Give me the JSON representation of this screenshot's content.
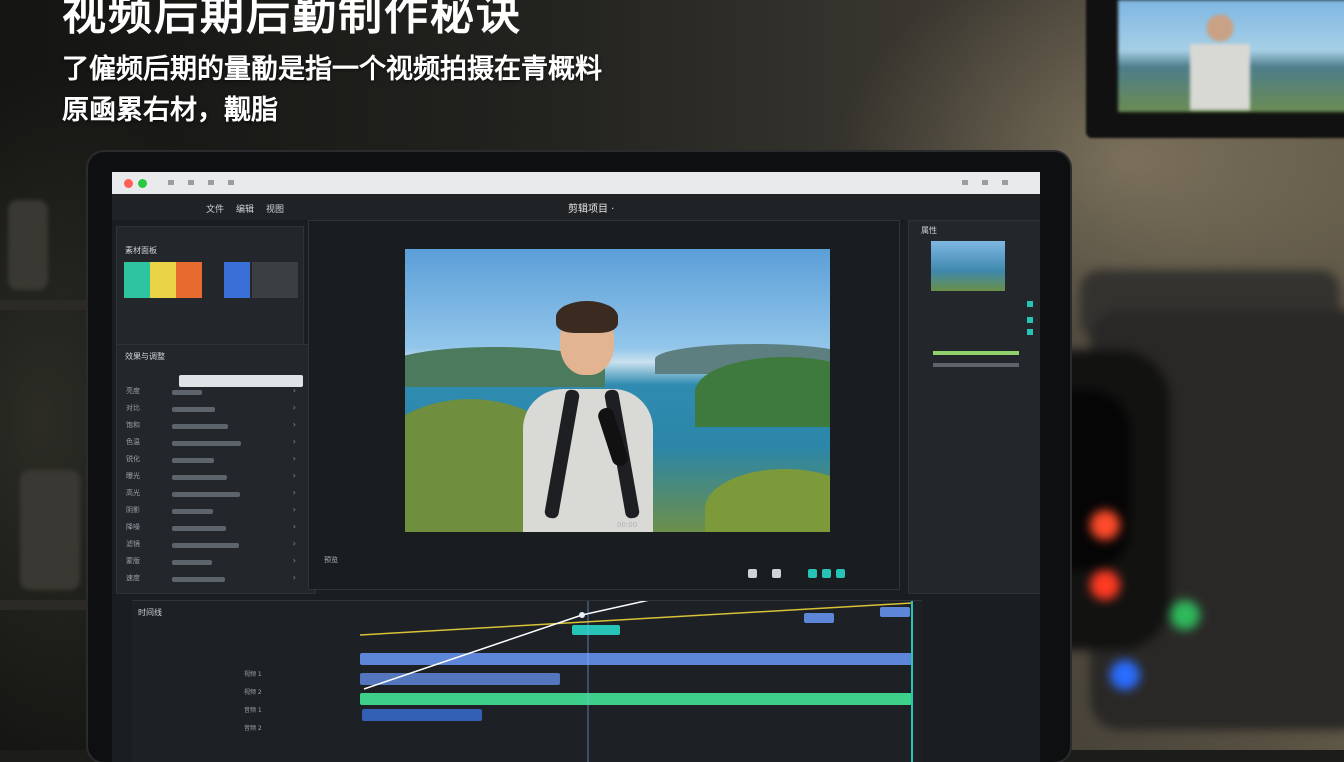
{
  "headline": {
    "title": "视频后期后勤制作秘诀",
    "subtitle_line1": "了僱频后期的量勈是指一个视频拍摄在青概料",
    "subtitle_line2": "原凾累右材，觏脂"
  },
  "editor": {
    "project_title": "剪辑项目 ·",
    "menu": [
      "文件",
      "编辑",
      "视图"
    ],
    "left_panel": {
      "title": "素材面板",
      "swatch_colors": [
        "#2ec4a0",
        "#e9d448",
        "#e86a2e",
        "#3a6fd8",
        "#3b3f44"
      ],
      "effects_title": "效果与调整",
      "items": [
        "亮度",
        "对比",
        "饱和",
        "色温",
        "锐化",
        "曝光",
        "高光",
        "阴影",
        "降噪",
        "滤镜",
        "蒙版",
        "速度"
      ]
    },
    "preview": {
      "timecode": "00:00",
      "status": "预览"
    },
    "right_panel": {
      "title": "属性"
    },
    "timeline": {
      "title": "时间线",
      "tracks": [
        "视频 1",
        "视频 2",
        "音频 1",
        "音频 2"
      ]
    },
    "colors": {
      "accent_teal": "#27c3b6",
      "track_blue": "#5d86d8",
      "track_green": "#3ed08a",
      "keyframe_line_yellow": "#d8c238"
    }
  }
}
